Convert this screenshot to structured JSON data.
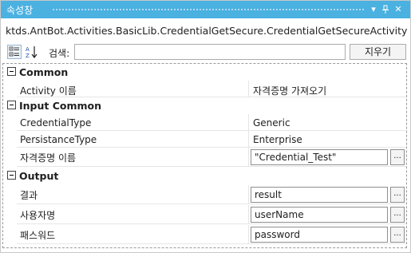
{
  "window": {
    "title": "속성창",
    "buttons": {
      "dropdown": "▾",
      "pin": "ᅮ",
      "close": "✕"
    }
  },
  "activity_path": "ktds.AntBot.Activities.BasicLib.CredentialGetSecure.CredentialGetSecureActivity",
  "toolbar": {
    "search_label": "검색:",
    "search_value": "",
    "clear_label": "지우기"
  },
  "grid": {
    "common": {
      "label": "Common",
      "rows": [
        {
          "name": "Activity 이름",
          "value": "자격증명 가져오기"
        }
      ]
    },
    "input_common": {
      "label": "Input Common",
      "rows": [
        {
          "name": "CredentialType",
          "value": "Generic"
        },
        {
          "name": "PersistanceType",
          "value": "Enterprise"
        },
        {
          "name": "자격증명 이름",
          "value": "\"Credential_Test\""
        }
      ]
    },
    "output": {
      "label": "Output",
      "rows": [
        {
          "name": "결과",
          "value": "result"
        },
        {
          "name": "사용자명",
          "value": "userName"
        },
        {
          "name": "패스워드",
          "value": "password"
        }
      ]
    }
  },
  "ellipsis_label": "...",
  "colors": {
    "titlebar": "#4ab1e1",
    "border": "#c9c9c9"
  },
  "icons": [
    "sort-by-category-icon",
    "sort-alphabetical-icon",
    "chevron-down-icon",
    "pin-icon",
    "close-icon"
  ]
}
